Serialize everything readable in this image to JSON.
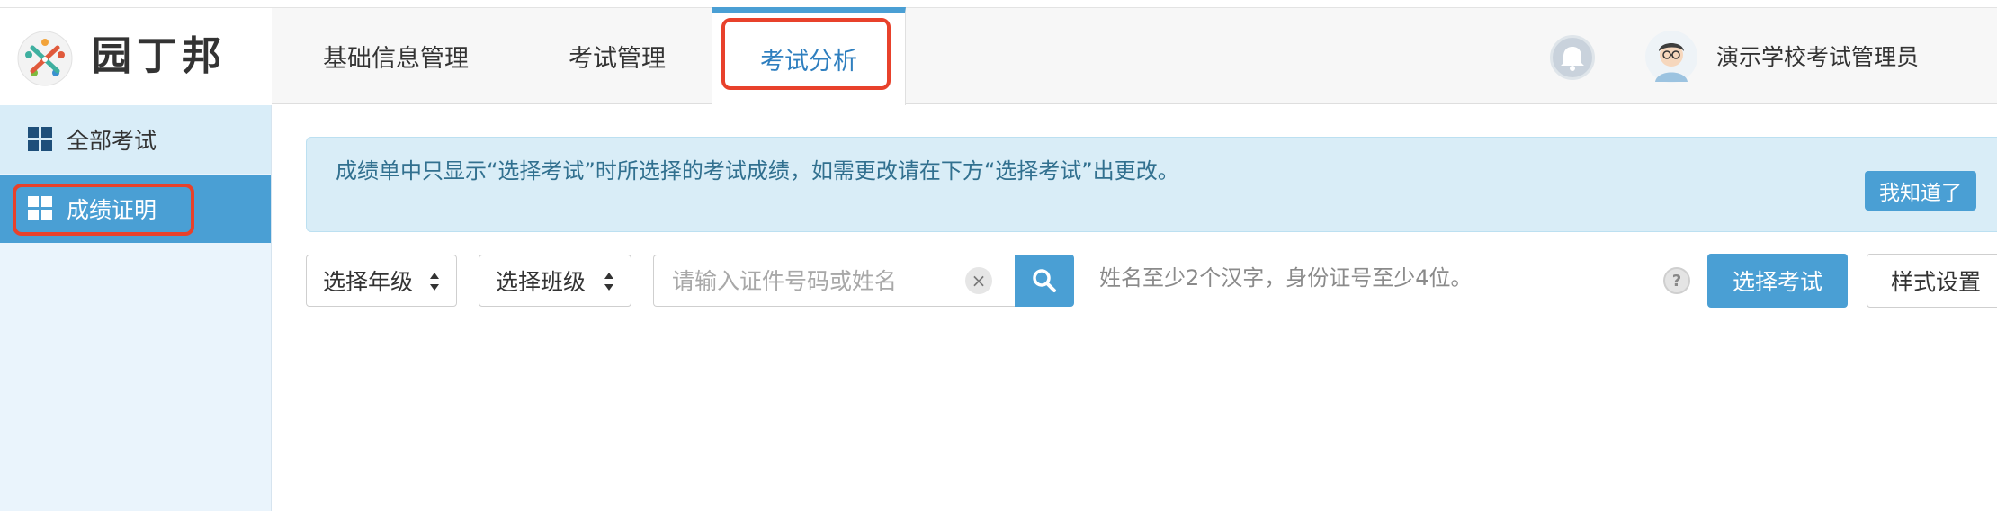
{
  "brand": {
    "name": "园丁邦"
  },
  "nav": {
    "tabs": [
      {
        "label": "基础信息管理"
      },
      {
        "label": "考试管理"
      },
      {
        "label": "考试分析",
        "active": true
      }
    ]
  },
  "user": {
    "name": "演示学校考试管理员",
    "icons": [
      "bell-icon",
      "avatar"
    ]
  },
  "sidebar": {
    "items": [
      {
        "label": "全部考试",
        "icon": "grid-icon"
      },
      {
        "label": "成绩证明",
        "icon": "grid-icon",
        "active": true
      }
    ]
  },
  "notice": {
    "text": "成绩单中只显示“选择考试”时所选择的考试成绩，如需更改请在下方“选择考试”出更改。",
    "button_label": "我知道了"
  },
  "filters": {
    "grade_select": "选择年级",
    "class_select": "选择班级",
    "search_placeholder": "请输入证件号码或姓名",
    "hint": "姓名至少2个汉字，身份证号至少4位。",
    "help_label": "?",
    "clear_label": "×"
  },
  "actions": {
    "select_exam": "选择考试",
    "style_settings": "样式设置"
  },
  "colors": {
    "accent": "#4a9fd4",
    "highlight": "#e8412b",
    "notice_bg": "#d9edf7",
    "sidebar_bg": "#eaf4fc"
  }
}
